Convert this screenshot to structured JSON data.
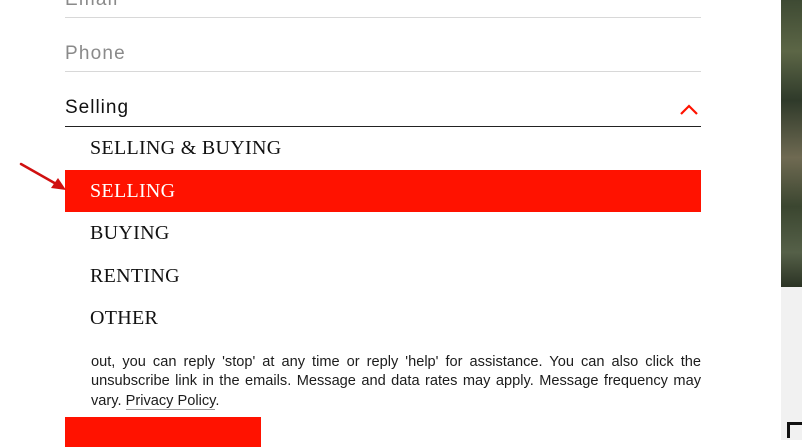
{
  "form": {
    "email_label": "Email",
    "phone_label": "Phone",
    "interest_select": {
      "value": "Selling",
      "options": [
        "SELLING & BUYING",
        "SELLING",
        "BUYING",
        "RENTING",
        "OTHER"
      ],
      "selected_index": 1
    },
    "disclaimer_text": "out, you can reply 'stop' at any time or reply 'help' for assistance. You can also click the unsubscribe link in the emails. Message and data rates may apply. Message frequency may vary.",
    "privacy_link": "Privacy Policy",
    "submit_label": ""
  },
  "colors": {
    "accent": "#ff1200",
    "text": "#111111",
    "muted": "#8a8a8a"
  },
  "icons": {
    "select_toggle": "chevron-up-icon",
    "annotation": "arrow-icon"
  }
}
